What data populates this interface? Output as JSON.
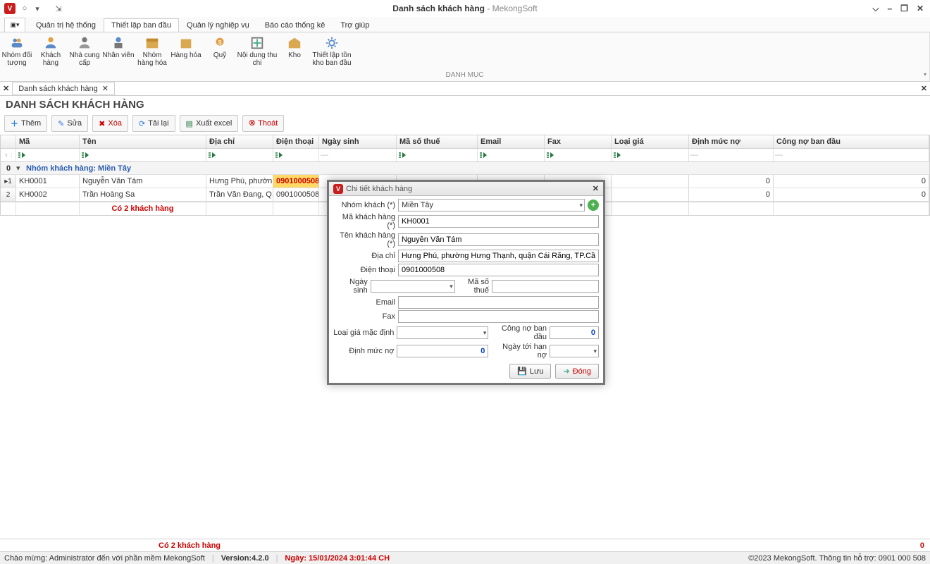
{
  "title": {
    "main": "Danh sách khách hàng",
    "suffix": " - MekongSoft"
  },
  "ribbon_tabs": [
    "Quản trị hệ thống",
    "Thiết lập ban đầu",
    "Quản lý nghiệp vụ",
    "Báo cáo thống kê",
    "Trợ giúp"
  ],
  "ribbon": {
    "group_caption": "DANH MỤC",
    "items": [
      "Nhóm đối tượng",
      "Khách hàng",
      "Nhà cung cấp",
      "Nhân viên",
      "Nhóm hàng hóa",
      "Hàng hóa",
      "Quỹ",
      "Nội dung thu chi",
      "Kho",
      "Thiết lập tồn kho ban đầu"
    ]
  },
  "doctab": "Danh sách khách hàng",
  "page_title": "DANH SÁCH KHÁCH HÀNG",
  "toolbar": {
    "them": "Thêm",
    "sua": "Sửa",
    "xoa": "Xóa",
    "tailai": "Tải lại",
    "xuatexcel": "Xuất excel",
    "thoat": "Thoát"
  },
  "grid": {
    "headers": {
      "ma": "Mã",
      "ten": "Tên",
      "diachi": "Địa chỉ",
      "dienthoai": "Điện thoại",
      "ngaysinh": "Ngày sinh",
      "masothue": "Mã số thuế",
      "email": "Email",
      "fax": "Fax",
      "loaigia": "Loại giá",
      "dinhmucno": "Định mức nợ",
      "congno": "Công nợ ban đầu"
    },
    "group_label": "Nhóm khách hàng: Miền Tây",
    "rows": [
      {
        "idx": "1",
        "ma": "KH0001",
        "ten": "Nguyễn Văn Tám",
        "diachi": "Hưng Phú, phườn...",
        "dienthoai": "0901000508",
        "dinhmucno": "0",
        "congno": "0"
      },
      {
        "idx": "2",
        "ma": "KH0002",
        "ten": "Trần Hoàng Sa",
        "diachi": "Trần Văn Đang, Q...",
        "dienthoai": "0901000508",
        "dinhmucno": "0",
        "congno": "0"
      }
    ],
    "footer_count": "Có 2 khách hàng"
  },
  "summary": {
    "left": "Có 2 khách hàng",
    "right": "0"
  },
  "status": {
    "welcome": "Chào mừng: Administrator đến với phần mềm MekongSoft",
    "version_label": "Version: ",
    "version": "4.2.0",
    "date_label": "Ngày: ",
    "date": "15/01/2024 3:01:44 CH",
    "right": "©2023 MekongSoft. Thông tin hỗ trợ: 0901 000 508"
  },
  "dialog": {
    "title": "Chi tiết khách hàng",
    "labels": {
      "nhomkhach": "Nhóm khách (*)",
      "makhachhang": "Mã khách hàng (*)",
      "tenkhachhang": "Tên khách hàng (*)",
      "diachi": "Địa chỉ",
      "dienthoai": "Điện thoại",
      "ngaysinh": "Ngày sinh",
      "masothue": "Mã số thuế",
      "email": "Email",
      "fax": "Fax",
      "loaigiamacdinh": "Loại giá mặc định",
      "congnobandau": "Công nợ ban đầu",
      "dinhmucno": "Định mức nợ",
      "ngaytoihanno": "Ngày tới hạn nợ"
    },
    "values": {
      "nhomkhach": "Miền Tây",
      "makhachhang": "KH0001",
      "tenkhachhang": "Nguyễn Văn Tám",
      "diachi": "Hưng Phú, phường Hưng Thạnh, quận Cái Răng, TP.Cần Thơ",
      "dienthoai": "0901000508",
      "ngaysinh": "",
      "masothue": "",
      "email": "",
      "fax": "",
      "loaigiamacdinh": "",
      "congnobandau": "0",
      "dinhmucno": "0",
      "ngaytoihanno": ""
    },
    "buttons": {
      "luu": "Lưu",
      "dong": "Đóng"
    }
  }
}
